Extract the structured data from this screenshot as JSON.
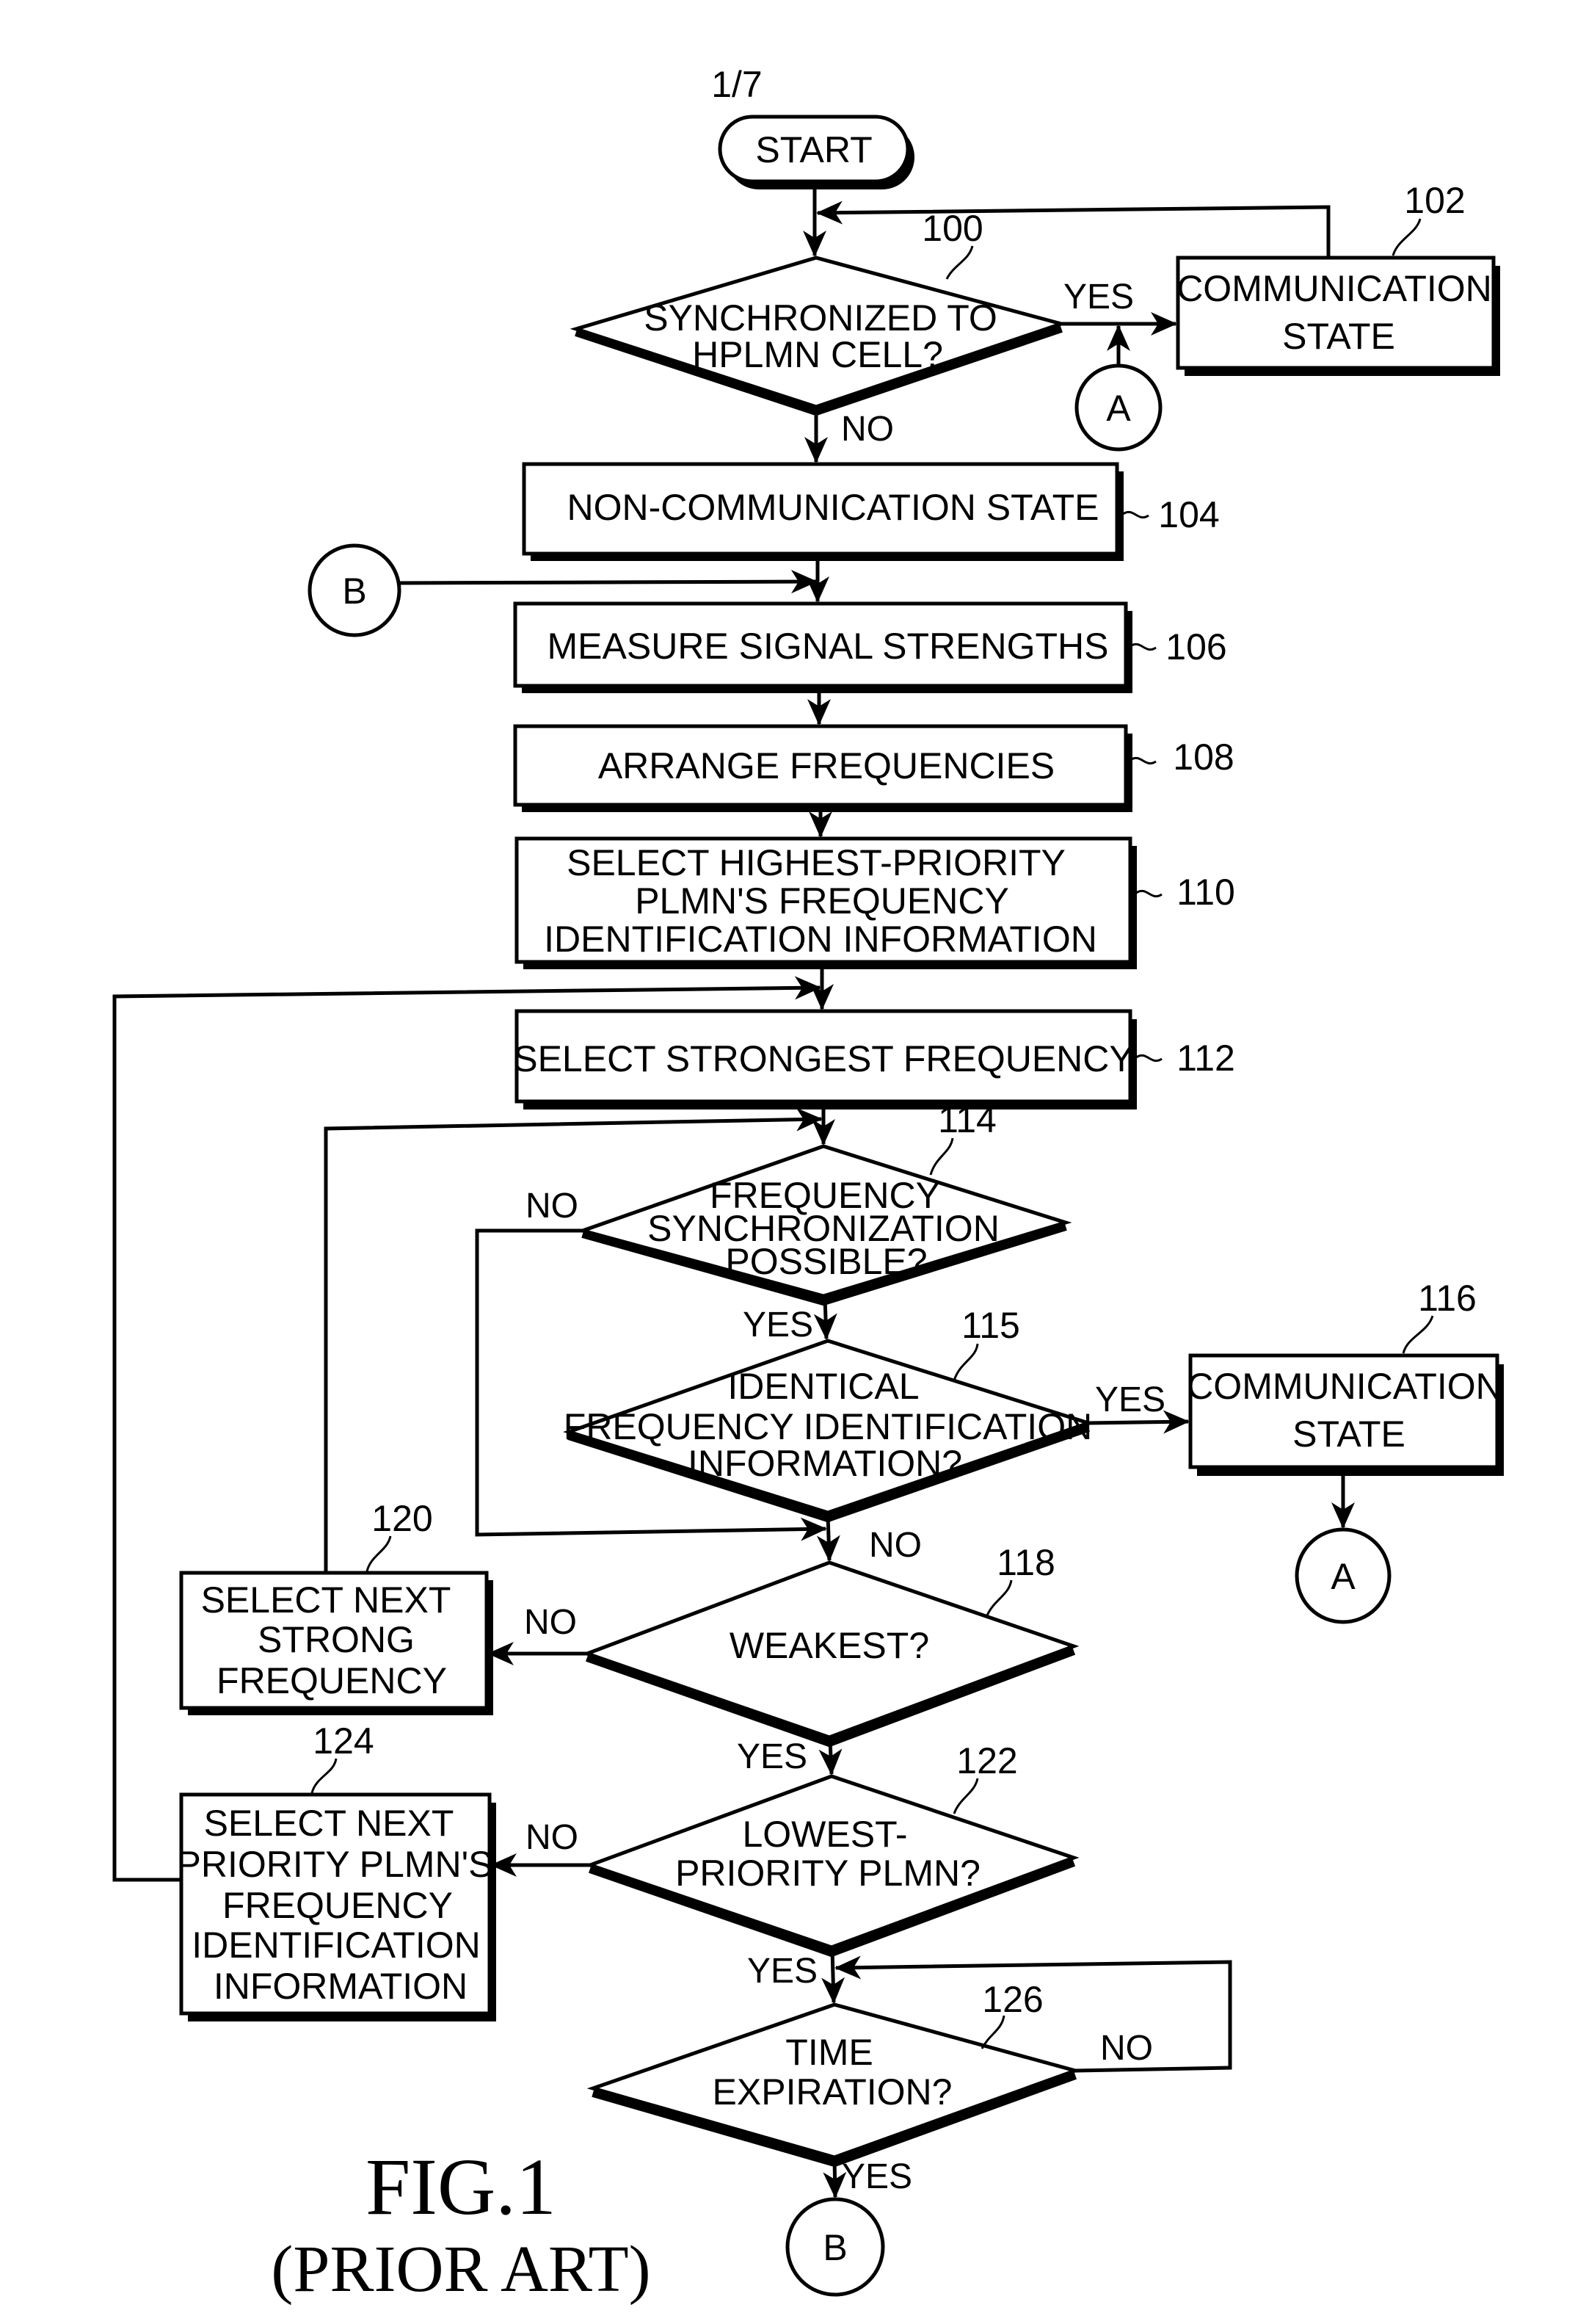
{
  "page": {
    "sheet_label": "1/7"
  },
  "figure": {
    "title": "FIG.1",
    "subtitle": "(PRIOR ART)"
  },
  "nodes": {
    "start": {
      "text": [
        "START"
      ]
    },
    "n100": {
      "ref": "100",
      "text": [
        "SYNCHRONIZED TO",
        "HPLMN CELL?"
      ]
    },
    "n102": {
      "ref": "102",
      "text": [
        "COMMUNICATION",
        "STATE"
      ]
    },
    "n104": {
      "ref": "104",
      "text": [
        "NON-COMMUNICATION STATE"
      ]
    },
    "n106": {
      "ref": "106",
      "text": [
        "MEASURE SIGNAL STRENGTHS"
      ]
    },
    "n108": {
      "ref": "108",
      "text": [
        "ARRANGE FREQUENCIES"
      ]
    },
    "n110": {
      "ref": "110",
      "text": [
        "SELECT HIGHEST-PRIORITY",
        "PLMN'S FREQUENCY",
        "IDENTIFICATION INFORMATION"
      ]
    },
    "n112": {
      "ref": "112",
      "text": [
        "SELECT STRONGEST FREQUENCY"
      ]
    },
    "n114": {
      "ref": "114",
      "text": [
        "FREQUENCY",
        "SYNCHRONIZATION",
        "POSSIBLE?"
      ]
    },
    "n115": {
      "ref": "115",
      "text": [
        "IDENTICAL",
        "FREQUENCY IDENTIFICATION",
        "INFORMATION?"
      ]
    },
    "n116": {
      "ref": "116",
      "text": [
        "COMMUNICATION",
        "STATE"
      ]
    },
    "n118": {
      "ref": "118",
      "text": [
        "WEAKEST?"
      ]
    },
    "n120": {
      "ref": "120",
      "text": [
        "SELECT NEXT",
        "STRONG",
        "FREQUENCY"
      ]
    },
    "n122": {
      "ref": "122",
      "text": [
        "LOWEST-",
        "PRIORITY PLMN?"
      ]
    },
    "n124": {
      "ref": "124",
      "text": [
        "SELECT NEXT",
        "PRIORITY PLMN'S",
        "FREQUENCY",
        "IDENTIFICATION",
        "INFORMATION"
      ]
    },
    "n126": {
      "ref": "126",
      "text": [
        "TIME",
        "EXPIRATION?"
      ]
    }
  },
  "connectors": {
    "a_top": "A",
    "a_bottom": "A",
    "b_left": "B",
    "b_bottom": "B"
  },
  "edge_labels": {
    "n100_yes": "YES",
    "n100_no": "NO",
    "n114_no": "NO",
    "n114_yes": "YES",
    "n115_yes": "YES",
    "n115_no": "NO",
    "n118_no": "NO",
    "n118_yes": "YES",
    "n122_no": "NO",
    "n122_yes": "YES",
    "n126_no": "NO",
    "n126_yes": "YES"
  }
}
